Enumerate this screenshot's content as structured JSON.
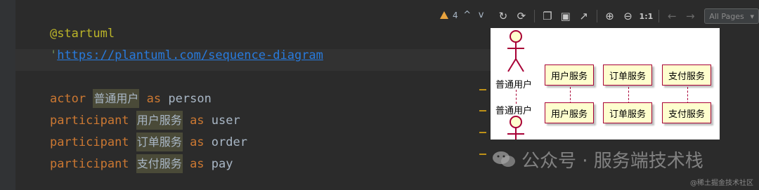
{
  "editor": {
    "lines": [
      {
        "text": "@startuml"
      },
      {
        "quote": "'",
        "url": "https://plantuml.com/sequence-diagram"
      },
      {
        "text": ""
      },
      {
        "keyword": "actor",
        "name": "普通用户",
        "as": "as",
        "alias": "person"
      },
      {
        "keyword": "participant",
        "name": "用户服务",
        "as": "as",
        "alias": "user"
      },
      {
        "keyword": "participant",
        "name": "订单服务",
        "as": "as",
        "alias": "order"
      },
      {
        "keyword": "participant",
        "name": "支付服务",
        "as": "as",
        "alias": "pay"
      }
    ],
    "inspection": {
      "warning_count": "4",
      "up_arrow": "^",
      "down_arrow": "v"
    }
  },
  "preview_toolbar": {
    "zoom_label": "1:1",
    "pages_select": "All Pages",
    "icons": [
      "refresh-icon",
      "reload-icon",
      "copy-icon",
      "save-icon",
      "open-external-icon",
      "zoom-in-icon",
      "zoom-out-icon",
      "prev-page-icon",
      "next-page-icon"
    ]
  },
  "diagram": {
    "actor": "普通用户",
    "participants": [
      "用户服务",
      "订单服务",
      "支付服务"
    ],
    "colors": {
      "box_fill": "#fefece",
      "border": "#a80036"
    }
  },
  "watermark": {
    "text": "公众号 · 服务端技术栈",
    "footer": "@稀土掘金技术社区"
  }
}
